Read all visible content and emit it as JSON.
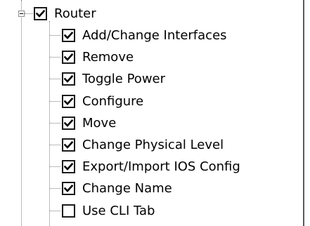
{
  "tree": {
    "root": {
      "label": "Router",
      "checked": true,
      "expanded": true,
      "expander_icon": "collapse-minus-icon"
    },
    "children": [
      {
        "label": "Add/Change Interfaces",
        "checked": true
      },
      {
        "label": "Remove",
        "checked": true
      },
      {
        "label": "Toggle Power",
        "checked": true
      },
      {
        "label": "Configure",
        "checked": true
      },
      {
        "label": "Move",
        "checked": true
      },
      {
        "label": "Change Physical Level",
        "checked": true
      },
      {
        "label": "Export/Import IOS Config",
        "checked": true
      },
      {
        "label": "Change Name",
        "checked": true
      },
      {
        "label": "Use CLI Tab",
        "checked": false
      }
    ]
  },
  "icons": {
    "checked": "checkmark-icon",
    "unchecked": "empty-checkbox-icon"
  },
  "colors": {
    "checkbox_border": "#1c1c1c",
    "tree_lines": "#7a7a7a",
    "panel_border": "#5a5a5a"
  }
}
